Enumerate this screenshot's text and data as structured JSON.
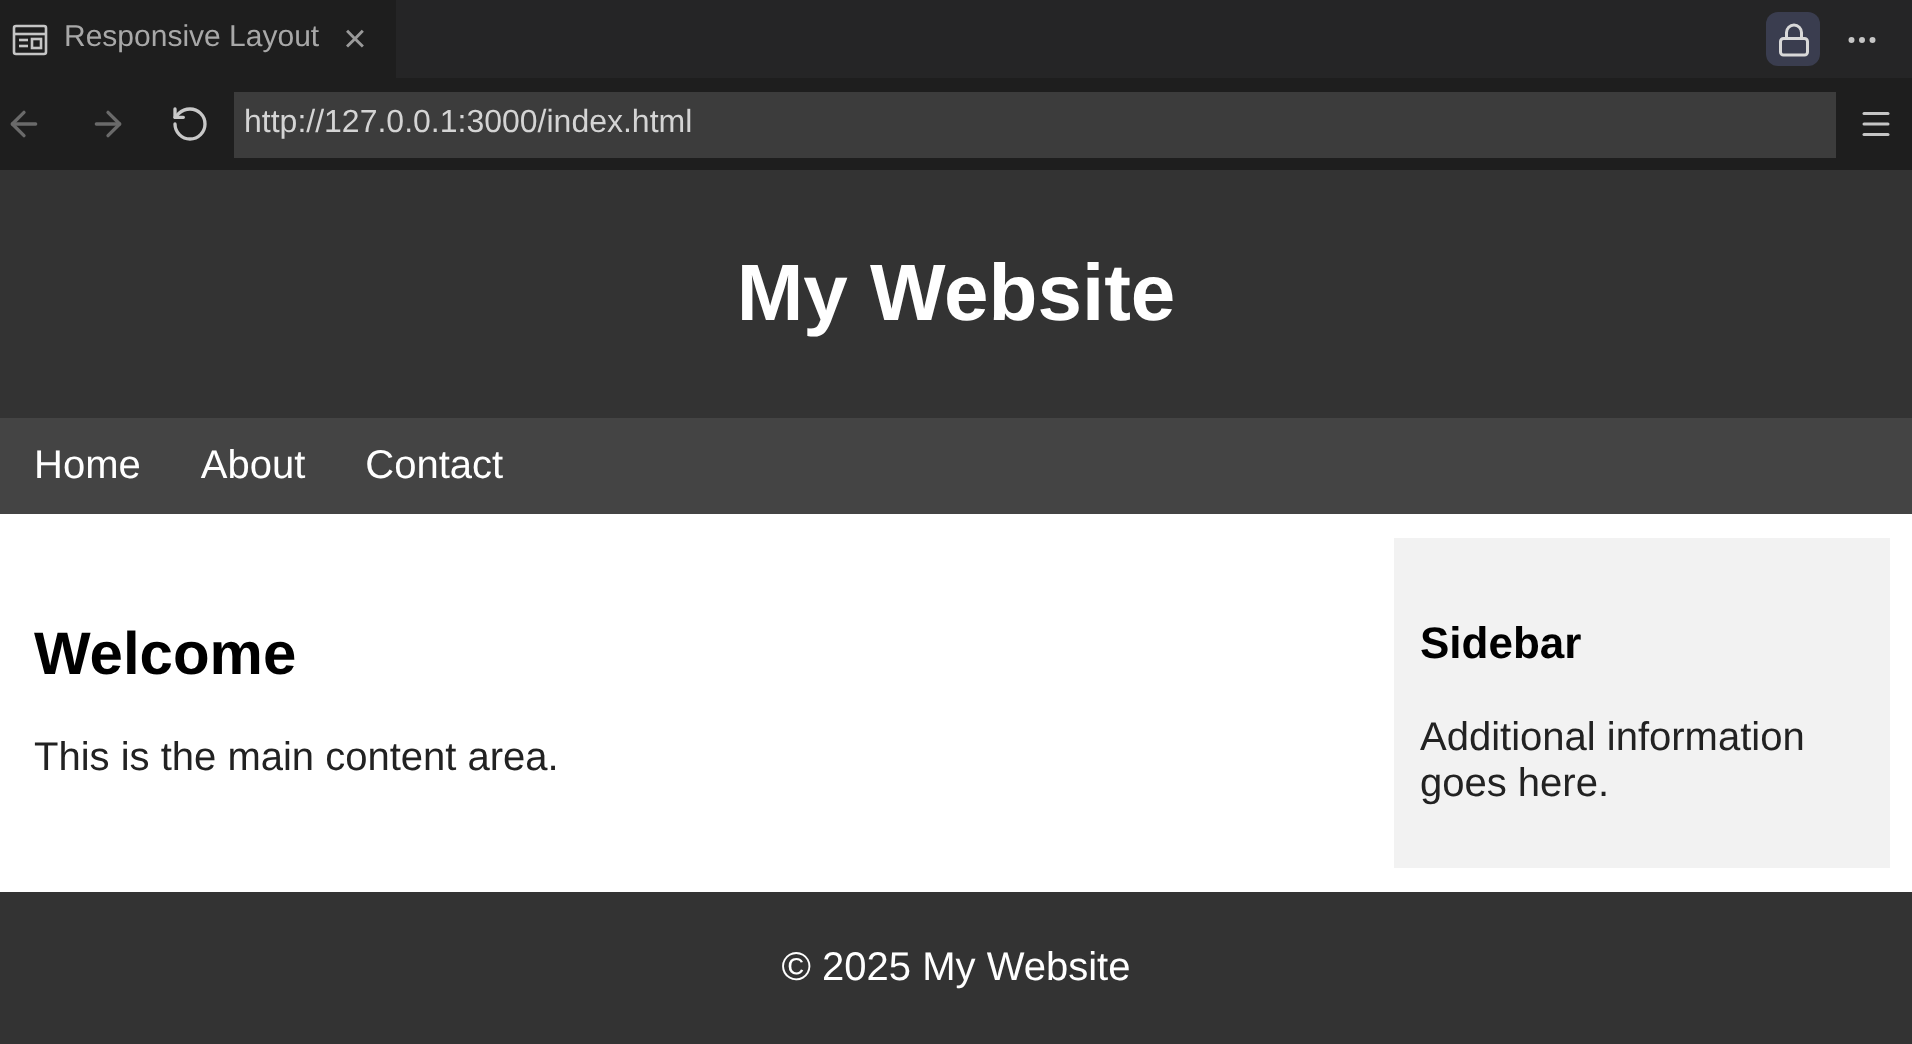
{
  "tab": {
    "title": "Responsive Layout",
    "close": "×"
  },
  "address": {
    "url": "http://127.0.0.1:3000/index.html"
  },
  "page": {
    "title": "My Website",
    "nav": [
      "Home",
      "About",
      "Contact"
    ],
    "main": {
      "heading": "Welcome",
      "text": "This is the main content area."
    },
    "sidebar": {
      "heading": "Sidebar",
      "text": "Additional information goes here."
    },
    "footer": "© 2025 My Website"
  }
}
